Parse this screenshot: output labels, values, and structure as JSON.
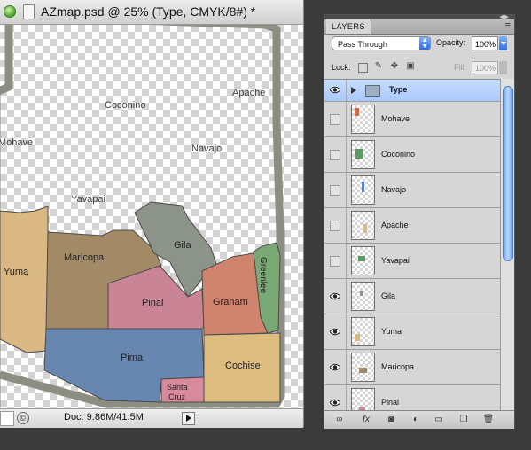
{
  "document": {
    "title": "AZmap.psd @ 25% (Type, CMYK/8#) *",
    "doc_info": "Doc: 9.86M/41.5M"
  },
  "map": {
    "county_labels": {
      "apache": "Apache",
      "coconino": "Coconino",
      "mohave": "Mohave",
      "navajo": "Navajo",
      "yavapai": "Yavapai",
      "gila": "Gila",
      "yuma": "Yuma",
      "maricopa": "Maricopa",
      "pinal": "Pinal",
      "graham": "Graham",
      "greenlee": "Greenlee",
      "pima": "Pima",
      "cochise": "Cochise",
      "santa_cruz_line1": "Santa",
      "santa_cruz_line2": "Cruz"
    },
    "colors": {
      "border": "#8e8d82",
      "yuma": "#d9b883",
      "maricopa": "#a38a66",
      "gila": "#8c948a",
      "pinal": "#c98496",
      "graham": "#d0846e",
      "greenlee": "#7aa875",
      "pima": "#6787b0",
      "cochise": "#ddbd7f",
      "santa_cruz": "#d88a9c"
    }
  },
  "layers_panel": {
    "tab_label": "LAYERS",
    "blend_mode": "Pass Through",
    "opacity_label": "Opacity:",
    "opacity_value": "100%",
    "lock_label": "Lock:",
    "fill_label": "Fill:",
    "fill_value": "100%",
    "layers": [
      {
        "name": "Type",
        "type": "group",
        "visible": true,
        "selected": true
      },
      {
        "name": "Mohave",
        "visible": false,
        "thumb_color": "#c96a4a"
      },
      {
        "name": "Coconino",
        "visible": false,
        "thumb_color": "#5a9a63"
      },
      {
        "name": "Navajo",
        "visible": false,
        "thumb_color": "#5b82b8"
      },
      {
        "name": "Apache",
        "visible": false,
        "thumb_color": "#d9b883"
      },
      {
        "name": "Yavapai",
        "visible": false,
        "thumb_color": "#5a9a63"
      },
      {
        "name": "Gila",
        "visible": true,
        "thumb_color": "#8c948a"
      },
      {
        "name": "Yuma",
        "visible": true,
        "thumb_color": "#d9b883"
      },
      {
        "name": "Maricopa",
        "visible": true,
        "thumb_color": "#a38a66"
      },
      {
        "name": "Pinal",
        "visible": true,
        "thumb_color": "#c98496"
      }
    ],
    "footer_icons": [
      "link-icon",
      "fx-icon",
      "mask-icon",
      "adjustment-icon",
      "new-group-icon",
      "new-layer-icon",
      "trash-icon"
    ]
  }
}
